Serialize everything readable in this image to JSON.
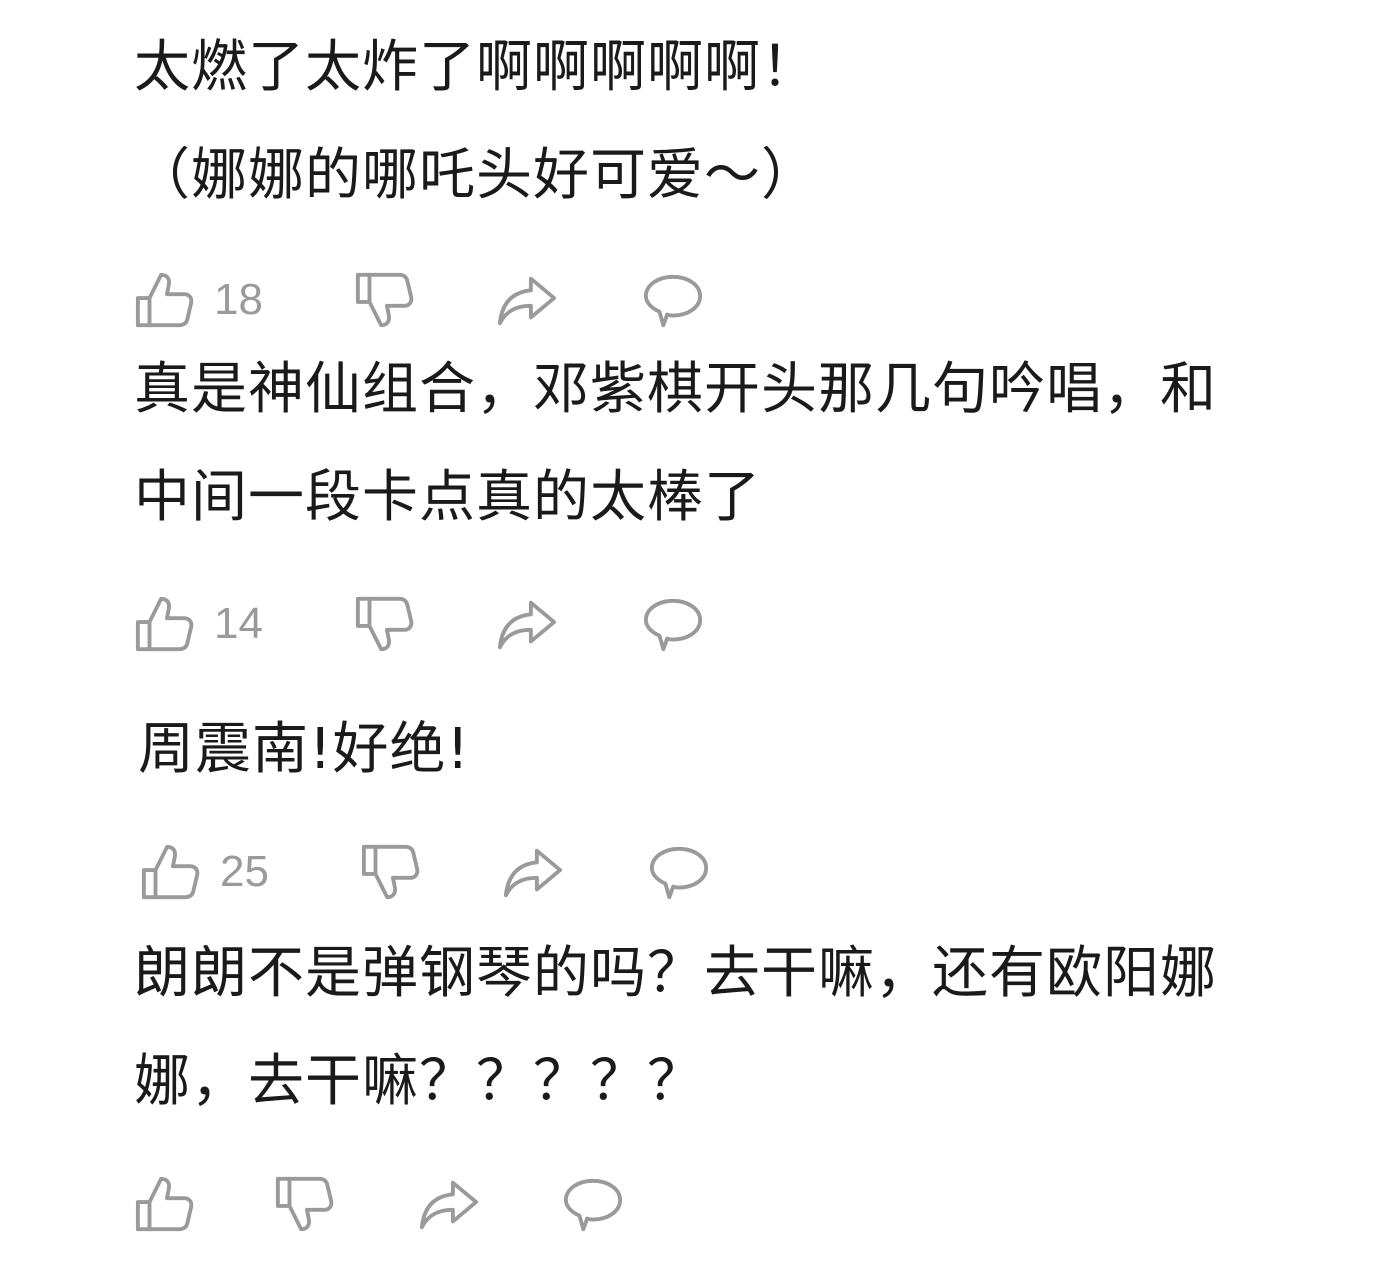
{
  "comments": [
    {
      "lines": [
        "太燃了太炸了啊啊啊啊啊！",
        "（娜娜的哪吒头好可爱～）"
      ],
      "like_count": "18",
      "icons": [
        "thumbs-up-icon",
        "thumbs-down-icon",
        "share-icon",
        "reply-icon"
      ]
    },
    {
      "lines": [
        "真是神仙组合，邓紫棋开头那几句吟唱，和",
        "中间一段卡点真的太棒了"
      ],
      "like_count": "14",
      "icons": [
        "thumbs-up-icon",
        "thumbs-down-icon",
        "share-icon",
        "reply-icon"
      ]
    },
    {
      "lines": [
        "周震南!好绝!"
      ],
      "like_count": "25",
      "icons": [
        "thumbs-up-icon",
        "thumbs-down-icon",
        "share-icon",
        "reply-icon"
      ]
    },
    {
      "lines": [
        "朗朗不是弹钢琴的吗？去干嘛，还有欧阳娜",
        "娜，去干嘛？？？？？"
      ],
      "like_count": "",
      "icons": [
        "thumbs-up-icon",
        "thumbs-down-icon",
        "share-icon",
        "reply-icon"
      ]
    }
  ],
  "colors": {
    "text": "#1a1a1a",
    "icon": "#9a9a9a",
    "background": "#ffffff"
  }
}
